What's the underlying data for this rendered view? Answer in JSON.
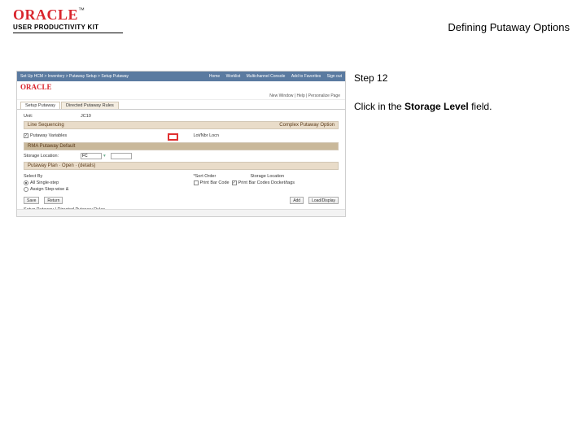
{
  "header": {
    "brand": "ORACLE",
    "sub": "USER PRODUCTIVITY KIT",
    "title": "Defining Putaway Options"
  },
  "panel": {
    "step": "Step 12",
    "instr_pre": "Click in the ",
    "instr_bold": "Storage Level",
    "instr_post": " field."
  },
  "shot": {
    "crumbs": "Set Up HCM > Inventory > Putaway Setup > Setup Putaway",
    "nav": {
      "home": "Home",
      "worklist": "Worklist",
      "tools": "Multichannel Console",
      "favs": "Add to Favorites",
      "signout": "Sign out"
    },
    "brand": "ORACLE",
    "subbar": "New Window | Help | Personalize Page",
    "tabs": {
      "t1": "Setup Putaway",
      "t2": "Directed Putaway Rules"
    },
    "unit_label": "Unit:",
    "unit_value": "JC10",
    "sec1": "Line Sequencing",
    "s1a": "Putaway Variables",
    "s1b": "Complex Putaway Option",
    "s1b_v": "Lot/Nbr Locn",
    "sec2": "RMA Putaway Default",
    "s2a": "Storage Location:",
    "s2a_v": "FC",
    "sec3": "Putaway Plan · Open · (details)",
    "s3a": "Select By",
    "r1": "All Single-step",
    "r2": "Assign Step-wise &",
    "s3b": "*Sort Order",
    "s3b_v": "Storage Location",
    "c1": "Print Bar Code",
    "c2": "Print Bar Codes Docket/tags",
    "btn_save": "Save",
    "btn_return": "Return",
    "btn_add": "Add",
    "btn_upd": "Load/Display",
    "bottom": "Setup Putaway | Directed Putaway Rules"
  }
}
